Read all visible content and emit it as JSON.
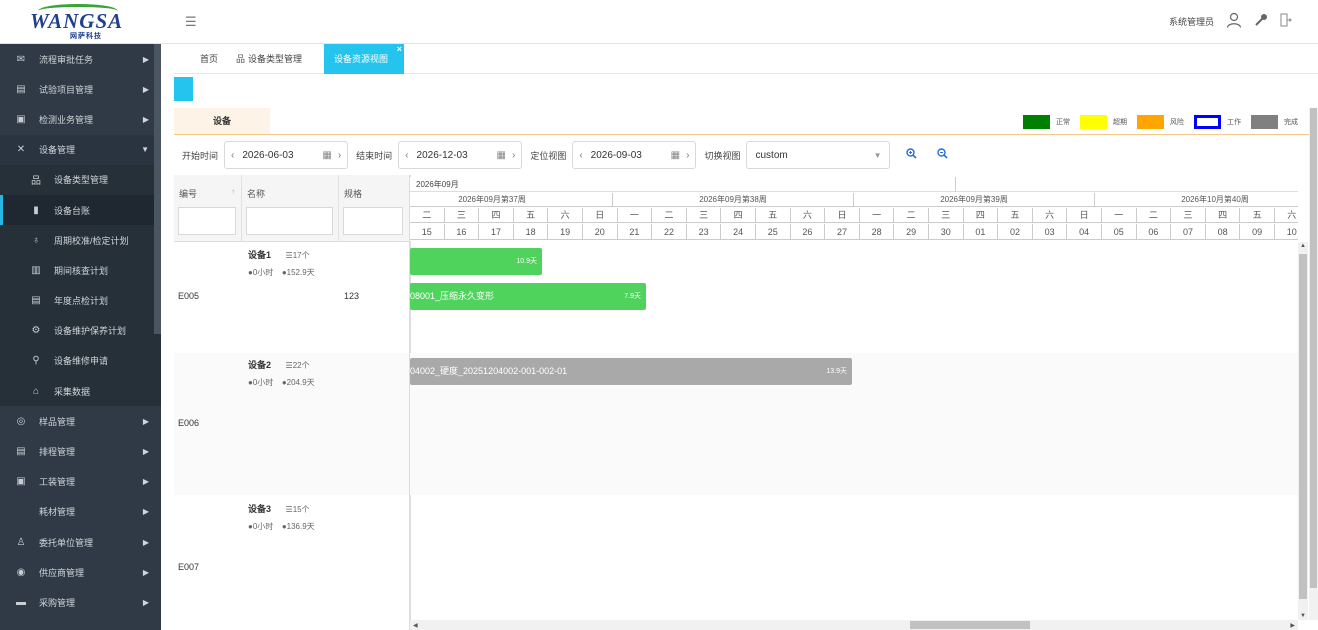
{
  "header": {
    "logo_text": "WANGSA",
    "logo_sub": "网萨科技",
    "user_name": "系统管理员"
  },
  "sidebar": {
    "items": [
      {
        "label": "流程审批任务",
        "icon": "✉",
        "arrow": "▶"
      },
      {
        "label": "试验项目管理",
        "icon": "▤",
        "arrow": "▶"
      },
      {
        "label": "检测业务管理",
        "icon": "▣",
        "arrow": "▶"
      },
      {
        "label": "设备管理",
        "icon": "✕",
        "arrow": "▼"
      },
      {
        "label": "设备类型管理",
        "icon": "品"
      },
      {
        "label": "设备台账",
        "icon": "▮"
      },
      {
        "label": "周期校准/检定计划",
        "icon": "♁"
      },
      {
        "label": "期间核查计划",
        "icon": "▥"
      },
      {
        "label": "年度点检计划",
        "icon": "▤"
      },
      {
        "label": "设备维护保养计划",
        "icon": "⚙"
      },
      {
        "label": "设备维修申请",
        "icon": "⚲"
      },
      {
        "label": "采集数据",
        "icon": "⌂"
      },
      {
        "label": "样品管理",
        "icon": "◎",
        "arrow": "▶"
      },
      {
        "label": "排程管理",
        "icon": "▤",
        "arrow": "▶"
      },
      {
        "label": "工装管理",
        "icon": "▣",
        "arrow": "▶"
      },
      {
        "label": "耗材管理",
        "icon": "",
        "arrow": "▶"
      },
      {
        "label": "委托单位管理",
        "icon": "♙",
        "arrow": "▶"
      },
      {
        "label": "供应商管理",
        "icon": "◉",
        "arrow": "▶"
      },
      {
        "label": "采购管理",
        "icon": "▬",
        "arrow": "▶"
      }
    ]
  },
  "tabs": {
    "home": "首页",
    "type_mgmt": "设备类型管理",
    "resource_view": "设备资源视图",
    "close": "×"
  },
  "panel": {
    "tab_label": "设备"
  },
  "legend": [
    {
      "label": "正常",
      "color": "#008000"
    },
    {
      "label": "超期",
      "color": "#ffff00"
    },
    {
      "label": "风险",
      "color": "#ffa500"
    },
    {
      "label": "工作",
      "color": "#0000ff"
    },
    {
      "label": "完成",
      "color": "#808080"
    }
  ],
  "filters": {
    "start_label": "开始时间",
    "start_value": "2026-06-03",
    "end_label": "结束时间",
    "end_value": "2026-12-03",
    "locate_label": "定位视图",
    "locate_value": "2026-09-03",
    "switch_label": "切换视图",
    "switch_value": "custom"
  },
  "columns": {
    "code": "编号",
    "name": "名称",
    "spec": "规格"
  },
  "timeline": {
    "month": "2026年09月",
    "weeks": [
      "2026年09月第37周",
      "2026年09月第38周",
      "2026年09月第39周",
      "2026年10月第40周"
    ],
    "dows": [
      "二",
      "三",
      "四",
      "五",
      "六",
      "日",
      "一",
      "二",
      "三",
      "四",
      "五",
      "六",
      "日",
      "一",
      "二",
      "三",
      "四",
      "五",
      "六",
      "日",
      "一",
      "二",
      "三",
      "四",
      "五",
      "六"
    ],
    "days": [
      "15",
      "16",
      "17",
      "18",
      "19",
      "20",
      "21",
      "22",
      "23",
      "24",
      "25",
      "26",
      "27",
      "28",
      "29",
      "30",
      "01",
      "02",
      "03",
      "04",
      "05",
      "06",
      "07",
      "08",
      "09",
      "10"
    ]
  },
  "rows": [
    {
      "code": "E005",
      "name": "设备1",
      "count": "17个",
      "hours": "0小时",
      "days": "152.9天",
      "spec": "123"
    },
    {
      "code": "E006",
      "name": "设备2",
      "count": "22个",
      "hours": "0小时",
      "days": "204.9天",
      "spec": ""
    },
    {
      "code": "E007",
      "name": "设备3",
      "count": "15个",
      "hours": "0小时",
      "days": "136.9天",
      "spec": ""
    }
  ],
  "bars": [
    {
      "label": "",
      "duration": "10.9天"
    },
    {
      "label": "08001_压缩永久变形",
      "duration": "7.9天"
    },
    {
      "label": "04002_硬度_20251204002-001-002-01",
      "duration": "13.9天"
    }
  ]
}
